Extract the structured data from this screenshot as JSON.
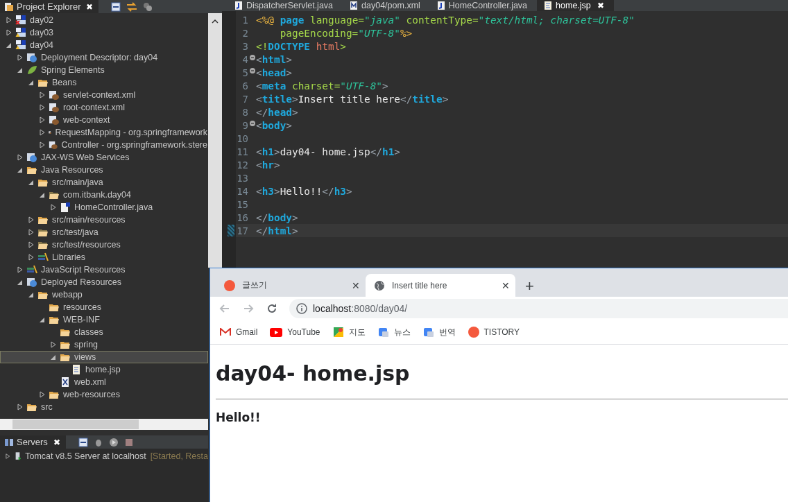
{
  "explorer": {
    "title": "Project Explorer",
    "close": "✖",
    "tree": [
      {
        "label": "day02",
        "kind": "project-error",
        "expanded": false,
        "selected": false
      },
      {
        "label": "day03",
        "kind": "project",
        "expanded": false,
        "selected": false
      },
      {
        "label": "day04",
        "kind": "project",
        "expanded": true,
        "selected": false,
        "children": [
          {
            "label": "Deployment Descriptor: day04",
            "kind": "descriptor",
            "expanded": false,
            "selected": false
          },
          {
            "label": "Spring Elements",
            "kind": "leaf",
            "expanded": true,
            "selected": false,
            "children": [
              {
                "label": "Beans",
                "kind": "folder",
                "expanded": true,
                "selected": false,
                "children": [
                  {
                    "label": "servlet-context.xml",
                    "kind": "bean",
                    "expanded": false,
                    "selected": false
                  },
                  {
                    "label": "root-context.xml",
                    "kind": "bean",
                    "expanded": false,
                    "selected": false
                  },
                  {
                    "label": "web-context",
                    "kind": "bean",
                    "expanded": false,
                    "selected": false
                  },
                  {
                    "label": "RequestMapping - org.springframework",
                    "kind": "bean",
                    "expanded": false,
                    "selected": false
                  },
                  {
                    "label": "Controller - org.springframework.stere",
                    "kind": "bean",
                    "expanded": false,
                    "selected": false
                  }
                ]
              }
            ]
          },
          {
            "label": "JAX-WS Web Services",
            "kind": "globe",
            "expanded": false,
            "selected": false
          },
          {
            "label": "Java Resources",
            "kind": "folder",
            "expanded": true,
            "selected": false,
            "children": [
              {
                "label": "src/main/java",
                "kind": "folder",
                "expanded": true,
                "selected": false,
                "children": [
                  {
                    "label": "com.itbank.day04",
                    "kind": "package",
                    "expanded": true,
                    "selected": false,
                    "children": [
                      {
                        "label": "HomeController.java",
                        "kind": "java",
                        "expanded": false,
                        "selected": false
                      }
                    ]
                  }
                ]
              },
              {
                "label": "src/main/resources",
                "kind": "folder",
                "expanded": false,
                "selected": false
              },
              {
                "label": "src/test/java",
                "kind": "package",
                "expanded": false,
                "selected": false
              },
              {
                "label": "src/test/resources",
                "kind": "package",
                "expanded": false,
                "selected": false
              },
              {
                "label": "Libraries",
                "kind": "library",
                "expanded": false,
                "selected": false
              }
            ]
          },
          {
            "label": "JavaScript Resources",
            "kind": "library",
            "expanded": false,
            "selected": false
          },
          {
            "label": "Deployed Resources",
            "kind": "globe",
            "expanded": true,
            "selected": false,
            "children": [
              {
                "label": "webapp",
                "kind": "folder",
                "expanded": true,
                "selected": false,
                "children": [
                  {
                    "label": "resources",
                    "kind": "folder",
                    "selected": false
                  },
                  {
                    "label": "WEB-INF",
                    "kind": "folder",
                    "expanded": true,
                    "selected": false,
                    "children": [
                      {
                        "label": "classes",
                        "kind": "folder",
                        "selected": false
                      },
                      {
                        "label": "spring",
                        "kind": "folder",
                        "expanded": false,
                        "selected": false
                      },
                      {
                        "label": "views",
                        "kind": "folder",
                        "expanded": true,
                        "selected": true,
                        "children": [
                          {
                            "label": "home.jsp",
                            "kind": "jsp",
                            "selected": false
                          }
                        ]
                      },
                      {
                        "label": "web.xml",
                        "kind": "xml",
                        "selected": false
                      }
                    ]
                  },
                  {
                    "label": "web-resources",
                    "kind": "folder",
                    "expanded": false,
                    "selected": false
                  }
                ]
              }
            ]
          },
          {
            "label": "src",
            "kind": "folder",
            "expanded": false,
            "selected": false
          }
        ]
      }
    ]
  },
  "servers": {
    "title": "Servers",
    "close": "✖",
    "rows": [
      {
        "label": "Tomcat v8.5 Server at localhost",
        "status": "[Started, Resta"
      }
    ]
  },
  "editor": {
    "tabs": [
      {
        "label": "DispatcherServlet.java",
        "kind": "java",
        "selected": false
      },
      {
        "label": "day04/pom.xml",
        "kind": "maven",
        "selected": false
      },
      {
        "label": "HomeController.java",
        "kind": "java",
        "selected": false
      },
      {
        "label": "home.jsp",
        "kind": "jsp",
        "selected": true,
        "close": "✖"
      }
    ],
    "lines": [
      {
        "number": "1",
        "tokens": [
          {
            "kind": "directive",
            "text": "<%@"
          },
          {
            "kind": "keyword",
            "text": " page"
          },
          {
            "kind": "attr",
            "text": " language="
          },
          {
            "kind": "value",
            "text": "\"java\""
          },
          {
            "kind": "attr",
            "text": " contentType="
          },
          {
            "kind": "value",
            "text": "\"text/html; charset=UTF-8\""
          }
        ]
      },
      {
        "number": "2",
        "tokens": [
          {
            "kind": "attr",
            "text": "    pageEncoding="
          },
          {
            "kind": "value",
            "text": "\"UTF-8\""
          },
          {
            "kind": "directive",
            "text": "%>"
          }
        ]
      },
      {
        "number": "3",
        "tokens": [
          {
            "kind": "decl",
            "text": "<!"
          },
          {
            "kind": "keyword",
            "text": "DOCTYPE"
          },
          {
            "kind": "doctype",
            "text": " html"
          },
          {
            "kind": "decl",
            "text": ">"
          }
        ]
      },
      {
        "number": "4",
        "fold": true,
        "tokens": [
          {
            "kind": "punct",
            "text": "<"
          },
          {
            "kind": "keyword",
            "text": "html"
          },
          {
            "kind": "punct",
            "text": ">"
          }
        ]
      },
      {
        "number": "5",
        "fold": true,
        "tokens": [
          {
            "kind": "punct",
            "text": "<"
          },
          {
            "kind": "keyword",
            "text": "head"
          },
          {
            "kind": "punct",
            "text": ">"
          }
        ]
      },
      {
        "number": "6",
        "tokens": [
          {
            "kind": "punct",
            "text": "<"
          },
          {
            "kind": "keyword",
            "text": "meta"
          },
          {
            "kind": "attr",
            "text": " charset="
          },
          {
            "kind": "value",
            "text": "\"UTF-8\""
          },
          {
            "kind": "punct",
            "text": ">"
          }
        ]
      },
      {
        "number": "7",
        "tokens": [
          {
            "kind": "punct",
            "text": "<"
          },
          {
            "kind": "keyword",
            "text": "title"
          },
          {
            "kind": "punct",
            "text": ">"
          },
          {
            "kind": "text",
            "text": "Insert title here"
          },
          {
            "kind": "punct",
            "text": "</"
          },
          {
            "kind": "keyword",
            "text": "title"
          },
          {
            "kind": "punct",
            "text": ">"
          }
        ]
      },
      {
        "number": "8",
        "tokens": [
          {
            "kind": "punct",
            "text": "</"
          },
          {
            "kind": "keyword",
            "text": "head"
          },
          {
            "kind": "punct",
            "text": ">"
          }
        ]
      },
      {
        "number": "9",
        "fold": true,
        "tokens": [
          {
            "kind": "punct",
            "text": "<"
          },
          {
            "kind": "keyword",
            "text": "body"
          },
          {
            "kind": "punct",
            "text": ">"
          }
        ]
      },
      {
        "number": "10"
      },
      {
        "number": "11",
        "tokens": [
          {
            "kind": "punct",
            "text": "<"
          },
          {
            "kind": "keyword",
            "text": "h1"
          },
          {
            "kind": "punct",
            "text": ">"
          },
          {
            "kind": "text",
            "text": "day04- home.jsp"
          },
          {
            "kind": "punct",
            "text": "</"
          },
          {
            "kind": "keyword",
            "text": "h1"
          },
          {
            "kind": "punct",
            "text": ">"
          }
        ]
      },
      {
        "number": "12",
        "tokens": [
          {
            "kind": "punct",
            "text": "<"
          },
          {
            "kind": "keyword",
            "text": "hr"
          },
          {
            "kind": "punct",
            "text": ">"
          }
        ]
      },
      {
        "number": "13"
      },
      {
        "number": "14",
        "tokens": [
          {
            "kind": "punct",
            "text": "<"
          },
          {
            "kind": "keyword",
            "text": "h3"
          },
          {
            "kind": "punct",
            "text": ">"
          },
          {
            "kind": "text",
            "text": "Hello!!"
          },
          {
            "kind": "punct",
            "text": "</"
          },
          {
            "kind": "keyword",
            "text": "h3"
          },
          {
            "kind": "punct",
            "text": ">"
          }
        ]
      },
      {
        "number": "15"
      },
      {
        "number": "16",
        "tokens": [
          {
            "kind": "punct",
            "text": "</"
          },
          {
            "kind": "keyword",
            "text": "body"
          },
          {
            "kind": "punct",
            "text": ">"
          }
        ]
      },
      {
        "number": "17",
        "current": true,
        "tokens": [
          {
            "kind": "punct",
            "text": "</"
          },
          {
            "kind": "keyword",
            "text": "html"
          },
          {
            "kind": "punct",
            "text": ">"
          }
        ]
      }
    ]
  },
  "browser": {
    "tabs": [
      {
        "label": "글쓰기",
        "kind": "tistory",
        "selected": false,
        "close": "✕"
      },
      {
        "label": "Insert title here",
        "kind": "globe",
        "selected": true,
        "close": "✕"
      }
    ],
    "new_tab": "+",
    "address": {
      "host": "localhost",
      "path": ":8080/day04/"
    },
    "bookmarks": [
      {
        "label": "Gmail",
        "kind": "gmail"
      },
      {
        "label": "YouTube",
        "kind": "youtube"
      },
      {
        "label": "지도",
        "kind": "maps"
      },
      {
        "label": "뉴스",
        "kind": "news"
      },
      {
        "label": "번역",
        "kind": "translate"
      },
      {
        "label": "TISTORY",
        "kind": "tistory"
      }
    ],
    "page": {
      "heading": "day04- home.jsp",
      "subheading": "Hello!!"
    }
  }
}
